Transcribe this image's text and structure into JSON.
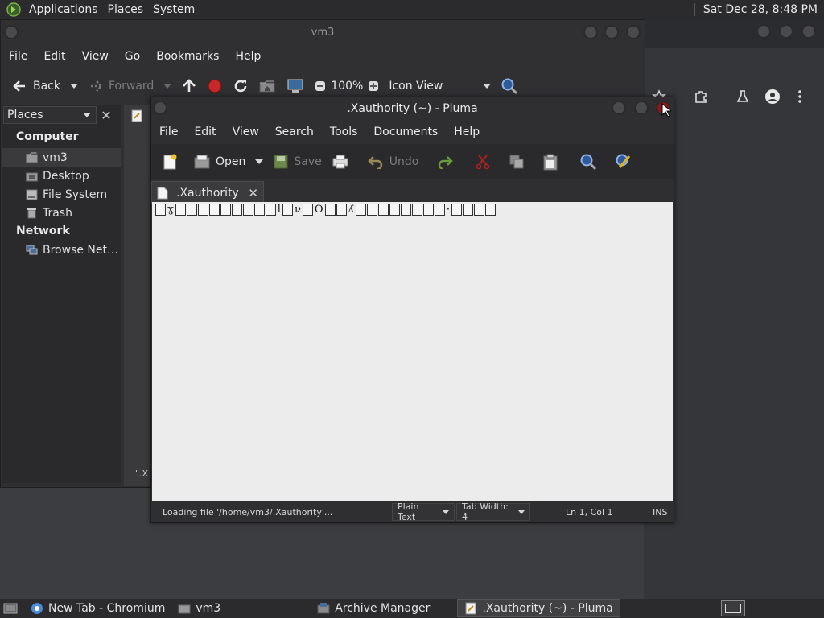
{
  "top_panel": {
    "menus": [
      "Applications",
      "Places",
      "System"
    ],
    "clock": "Sat Dec 28,  8:48 PM"
  },
  "caja": {
    "title": "vm3",
    "menus": [
      "File",
      "Edit",
      "View",
      "Go",
      "Bookmarks",
      "Help"
    ],
    "toolbar": {
      "back": "Back",
      "forward": "Forward",
      "zoom": "100%",
      "view_mode": "Icon View"
    },
    "sidebar": {
      "combo": "Places",
      "computer_heading": "Computer",
      "computer_items": [
        "vm3",
        "Desktop",
        "File System",
        "Trash"
      ],
      "network_heading": "Network",
      "network_items": [
        "Browse Net…"
      ]
    },
    "status_fragment": "\".X"
  },
  "pluma": {
    "title": ".Xauthority (~) - Pluma",
    "menus": [
      "File",
      "Edit",
      "View",
      "Search",
      "Tools",
      "Documents",
      "Help"
    ],
    "toolbar": {
      "open": "Open",
      "save": "Save",
      "undo": "Undo"
    },
    "tab_label": ".Xauthority",
    "editor_glyphs": [
      "x",
      "ɣ",
      "x",
      "x",
      "x",
      "x",
      "x",
      "x",
      "x",
      "x",
      "x",
      "l",
      "x",
      "ν",
      "x",
      "O",
      "x",
      "x",
      "ʎ",
      "x",
      "x",
      "x",
      "x",
      "x",
      "x",
      "x",
      "x",
      "·",
      "x",
      "x",
      "x",
      "x"
    ],
    "status": {
      "message": "Loading file '/home/vm3/.Xauthority'...",
      "language": "Plain Text",
      "tab_width": "Tab Width:  4",
      "position": "Ln 1, Col 1",
      "mode": "INS"
    }
  },
  "taskbar": {
    "tasks": [
      "New Tab - Chromium",
      "vm3",
      "Archive Manager",
      ".Xauthority (~) - Pluma"
    ]
  }
}
